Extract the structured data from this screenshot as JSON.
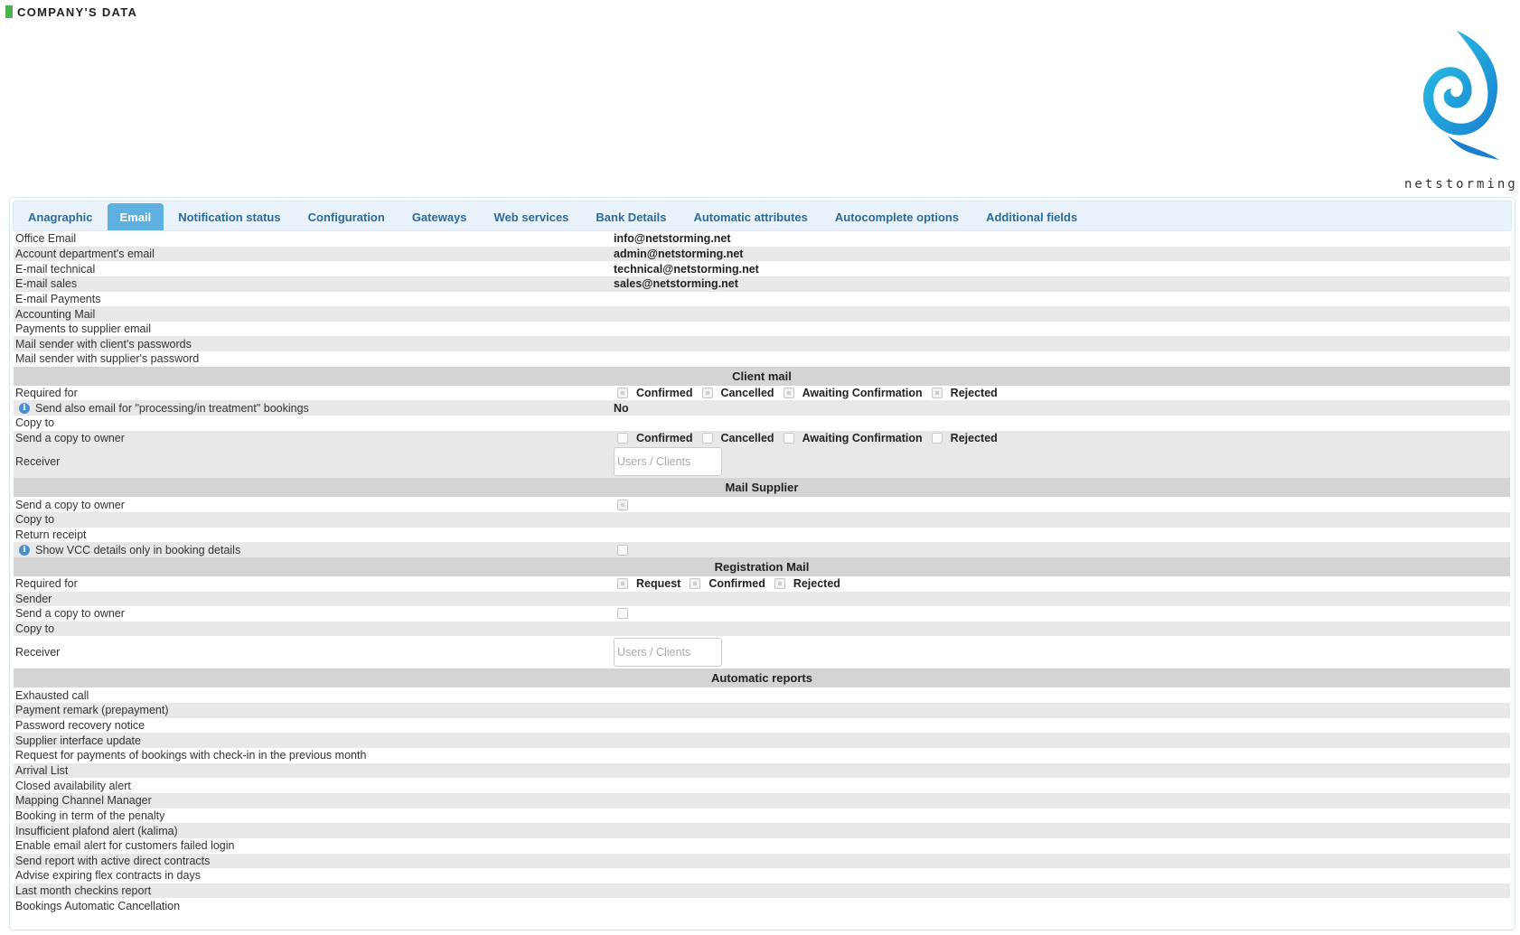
{
  "header": {
    "title": "COMPANY'S DATA"
  },
  "logo": {
    "text": "netstorming"
  },
  "tabs": [
    {
      "label": "Anagraphic",
      "active": false
    },
    {
      "label": "Email",
      "active": true
    },
    {
      "label": "Notification status",
      "active": false
    },
    {
      "label": "Configuration",
      "active": false
    },
    {
      "label": "Gateways",
      "active": false
    },
    {
      "label": "Web services",
      "active": false
    },
    {
      "label": "Bank Details",
      "active": false
    },
    {
      "label": "Automatic attributes",
      "active": false
    },
    {
      "label": "Autocomplete options",
      "active": false
    },
    {
      "label": "Additional fields",
      "active": false
    }
  ],
  "general": {
    "office_email": {
      "label": "Office Email",
      "value": "info@netstorming.net"
    },
    "account_email": {
      "label": "Account department's email",
      "value": "admin@netstorming.net"
    },
    "technical_email": {
      "label": "E-mail technical",
      "value": "technical@netstorming.net"
    },
    "sales_email": {
      "label": "E-mail sales",
      "value": "sales@netstorming.net"
    },
    "payments_email": {
      "label": "E-mail Payments",
      "value": ""
    },
    "accounting_mail": {
      "label": "Accounting Mail",
      "value": ""
    },
    "supplier_payments_email": {
      "label": "Payments to supplier email",
      "value": ""
    },
    "client_passwords_sender": {
      "label": "Mail sender with client's passwords",
      "value": ""
    },
    "supplier_password_sender": {
      "label": "Mail sender with supplier's password",
      "value": ""
    }
  },
  "client_mail": {
    "title": "Client mail",
    "required_for": {
      "label": "Required for",
      "options": [
        "Confirmed",
        "Cancelled",
        "Awaiting Confirmation",
        "Rejected"
      ]
    },
    "processing": {
      "label": "Send also email for \"processing/in treatment\" bookings",
      "value": "No"
    },
    "copy_to": {
      "label": "Copy to"
    },
    "copy_owner": {
      "label": "Send a copy to owner",
      "options": [
        "Confirmed",
        "Cancelled",
        "Awaiting Confirmation",
        "Rejected"
      ]
    },
    "receiver": {
      "label": "Receiver",
      "placeholder": "Users / Clients"
    }
  },
  "mail_supplier": {
    "title": "Mail Supplier",
    "copy_owner": {
      "label": "Send a copy to owner"
    },
    "copy_to": {
      "label": "Copy to"
    },
    "return_receipt": {
      "label": "Return receipt"
    },
    "vcc": {
      "label": "Show VCC details only in booking details"
    }
  },
  "registration_mail": {
    "title": "Registration Mail",
    "required_for": {
      "label": "Required for",
      "options": [
        "Request",
        "Confirmed",
        "Rejected"
      ]
    },
    "sender": {
      "label": "Sender"
    },
    "copy_owner": {
      "label": "Send a copy to owner"
    },
    "copy_to": {
      "label": "Copy to"
    },
    "receiver": {
      "label": "Receiver",
      "placeholder": "Users / Clients"
    }
  },
  "automatic_reports": {
    "title": "Automatic reports",
    "items": [
      "Exhausted call",
      "Payment remark (prepayment)",
      "Password recovery notice",
      "Supplier interface update",
      "Request for payments of bookings with check-in in the previous month",
      "Arrival List",
      "Closed availability alert",
      "Mapping Channel Manager",
      "Booking in term of the penalty",
      "Insufficient plafond alert (kalima)",
      "Enable email alert for customers failed login",
      "Send report with active direct contracts",
      "Advise expiring flex contracts in days",
      "Last month checkins report",
      "Bookings Automatic Cancellation"
    ]
  },
  "colors": {
    "accent": "#5eb0e0",
    "tab_text": "#2e6a9a",
    "header_marker": "#4caf50",
    "row_alt": "#e8e8e8",
    "section": "#d4d4d4"
  }
}
